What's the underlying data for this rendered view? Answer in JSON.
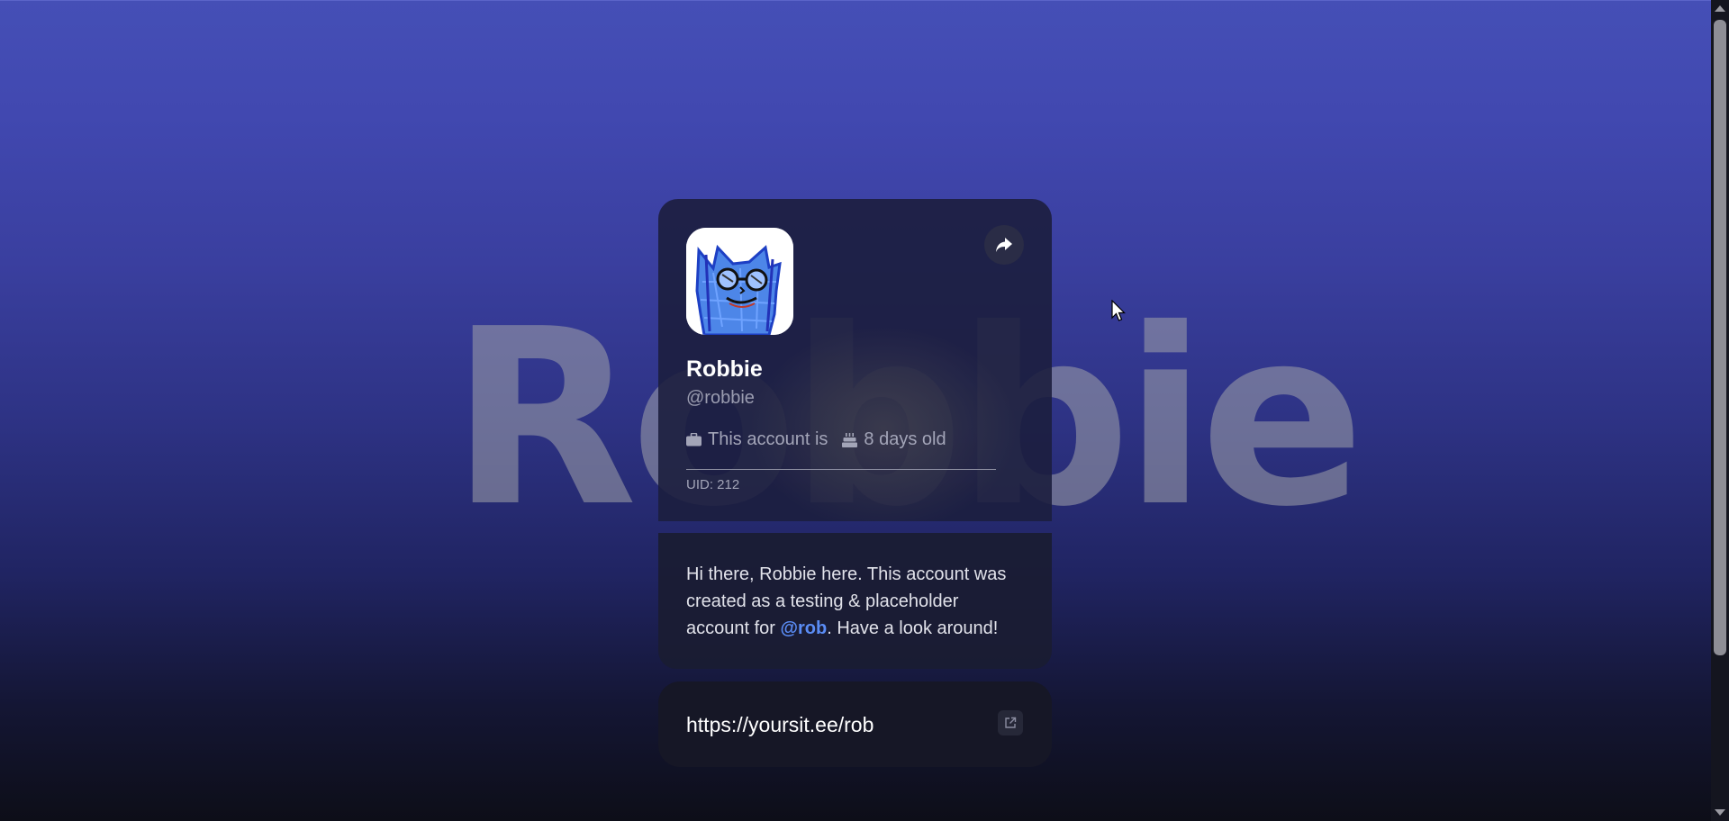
{
  "background": {
    "name_watermark": "Robbie",
    "gradient_top": "#454fb6",
    "gradient_bottom": "#0d0e18"
  },
  "profile": {
    "avatar_alt": "Robbie avatar",
    "display_name": "Robbie",
    "username": "@robbie",
    "badge_text": "This account is",
    "age_text": "8 days old",
    "uid_text": "UID: 212",
    "share_icon": "share-icon"
  },
  "bio": {
    "text_before": "Hi there, Robbie here. This account was created as a testing & placeholder account for ",
    "mention": "@rob",
    "text_after": ". Have a look around!",
    "mention_color": "#5a8cf5"
  },
  "link": {
    "url": "https://yoursit.ee/rob",
    "icon": "external-link-icon"
  }
}
